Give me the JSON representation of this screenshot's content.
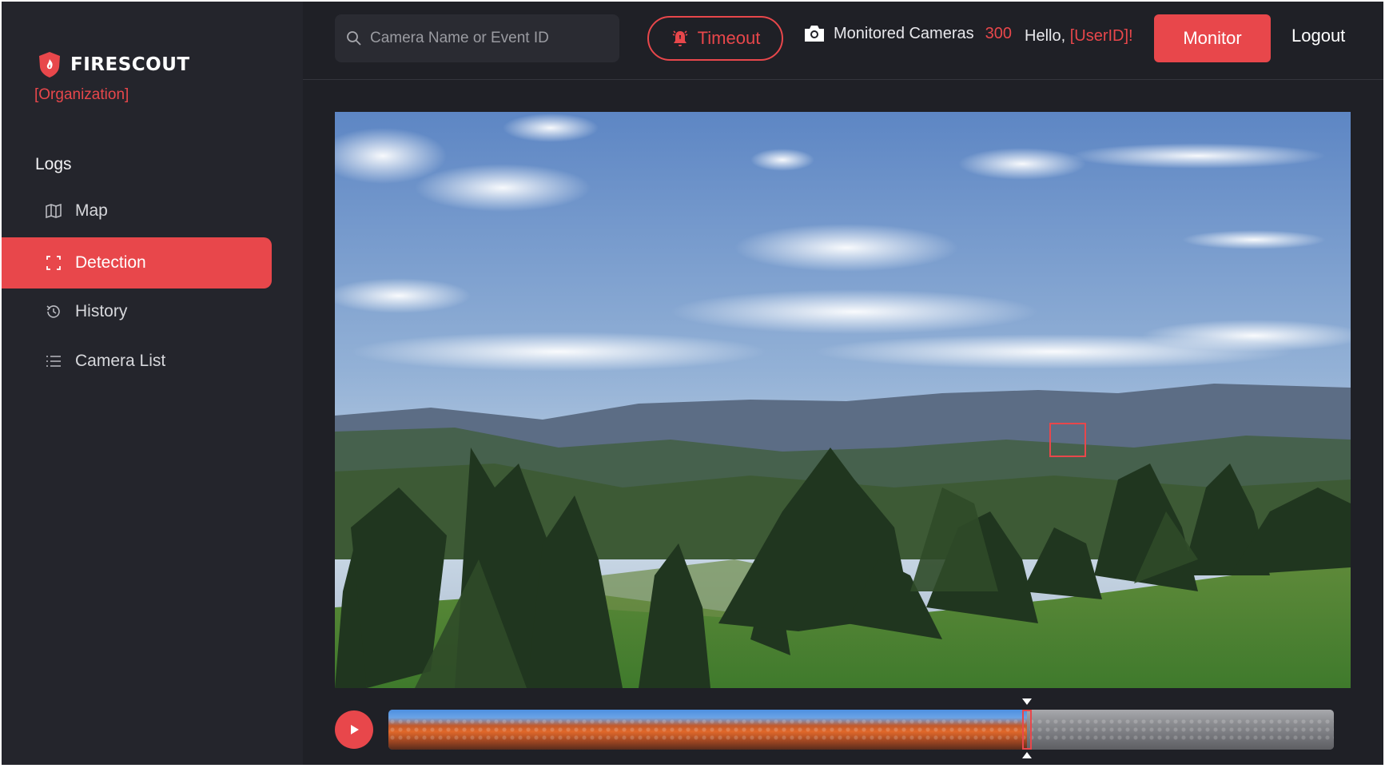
{
  "brand": {
    "name": "FIRESCOUT",
    "organization": "[Organization]",
    "accent_color": "#e8474b"
  },
  "sidebar": {
    "heading": "Logs",
    "items": [
      {
        "label": "Map",
        "icon": "map-icon",
        "active": false
      },
      {
        "label": "Detection",
        "icon": "focus-frame-icon",
        "active": true
      },
      {
        "label": "History",
        "icon": "history-clock-icon",
        "active": false
      },
      {
        "label": "Camera List",
        "icon": "list-icon",
        "active": false
      }
    ]
  },
  "topbar": {
    "search_placeholder": "Camera Name or Event ID",
    "timeout_label": "Timeout",
    "monitored_label": "Monitored Cameras",
    "monitored_count": "300",
    "hello_prefix": "Hello,",
    "user_id": "[UserID]!",
    "monitor_label": "Monitor",
    "logout_label": "Logout"
  },
  "player": {
    "progress": 0.675
  }
}
